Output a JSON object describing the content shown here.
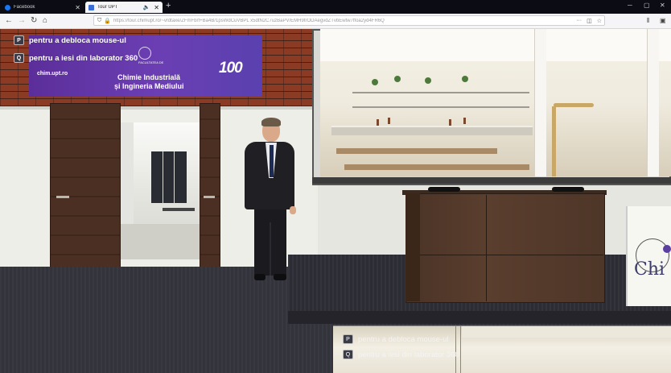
{
  "browser": {
    "tabs": [
      {
        "label": "Facebook",
        "icon": "facebook-icon",
        "color": "#1877f2",
        "active": false
      },
      {
        "label": "Tour UPT",
        "icon": "site-icon",
        "color": "#3b6bd6",
        "active": true
      }
    ],
    "new_tab": "+",
    "url": "https://tour.chimupt.ro/~vrdtaxe/ZFmFbrf+Ba4B/1psWdCuVBPL x5dtN2C7uzBaPV/EMH9trODAegvdZTvbEwtw7ffoa2yd4FR6Q",
    "window_controls": [
      "─",
      "▢",
      "✕"
    ]
  },
  "overlay": {
    "hints": [
      {
        "key": "P",
        "text": "pentru a debloca mouse-ul"
      },
      {
        "key": "Q",
        "text": "pentru a iesi din laborator 360"
      }
    ]
  },
  "banner": {
    "site": "chim.upt.ro",
    "title_line1": "Chimie Industrială",
    "title_line2": "și Ingineria Mediului",
    "logo_text": "100",
    "sub": "FACULTATEA DE"
  },
  "poster": {
    "text": "Chi"
  },
  "inset": {
    "hints": [
      {
        "key": "P",
        "text": "pentru a debloca mouse-ul"
      },
      {
        "key": "Q",
        "text": "pentru a iesi din laborator 360"
      }
    ]
  },
  "colors": {
    "banner_purple": "#5b2e9a",
    "brick": "#8b3a24",
    "wood": "#4b2f22",
    "floor": "#33333b"
  }
}
